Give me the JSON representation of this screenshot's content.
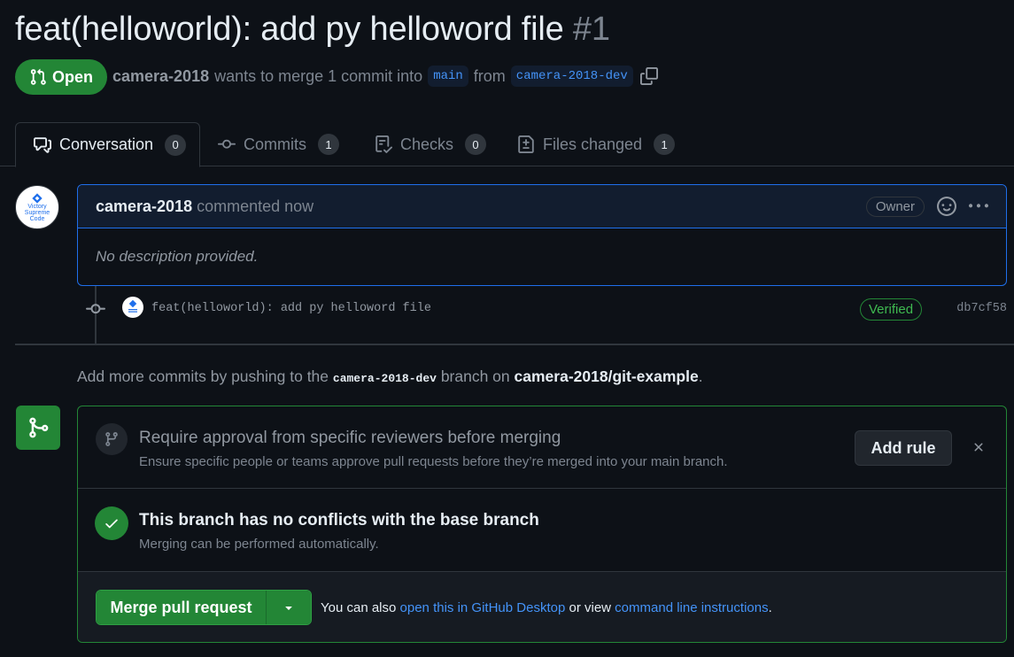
{
  "pr": {
    "title": "feat(helloworld): add py helloword file",
    "number": "#1",
    "state": "Open",
    "author": "camera-2018",
    "merge_text": "wants to merge 1 commit into",
    "base_branch": "main",
    "from_text": "from",
    "head_branch": "camera-2018-dev"
  },
  "tabs": [
    {
      "label": "Conversation",
      "count": "0",
      "icon": "comment-discussion-icon"
    },
    {
      "label": "Commits",
      "count": "1",
      "icon": "git-commit-icon"
    },
    {
      "label": "Checks",
      "count": "0",
      "icon": "checklist-icon"
    },
    {
      "label": "Files changed",
      "count": "1",
      "icon": "file-diff-icon"
    }
  ],
  "avatar": {
    "line1": "Victory",
    "line2": "Supreme",
    "line3": "Code"
  },
  "comment": {
    "author": "camera-2018",
    "action": "commented now",
    "badge": "Owner",
    "body": "No description provided."
  },
  "commit": {
    "message": "feat(helloworld): add py helloword file",
    "verified": "Verified",
    "sha": "db7cf58"
  },
  "hint": {
    "pre": "Add more commits by pushing to the",
    "branch": "camera-2018-dev",
    "mid": "branch on",
    "repo": "camera-2018/git-example",
    "post": "."
  },
  "merge": {
    "rule_title": "Require approval from specific reviewers before merging",
    "rule_sub": "Ensure specific people or teams approve pull requests before they’re merged into your main branch.",
    "add_rule": "Add rule",
    "status_title": "This branch has no conflicts with the base branch",
    "status_sub": "Merging can be performed automatically.",
    "merge_button": "Merge pull request",
    "also_pre": "You can also",
    "desktop_link": "open this in GitHub Desktop",
    "or_view": "or view",
    "cli_link": "command line instructions",
    "also_post": "."
  },
  "colors": {
    "background": "#0d1117",
    "accent_green": "#238636",
    "accent_blue": "#1f6feb",
    "link": "#4493f8"
  }
}
